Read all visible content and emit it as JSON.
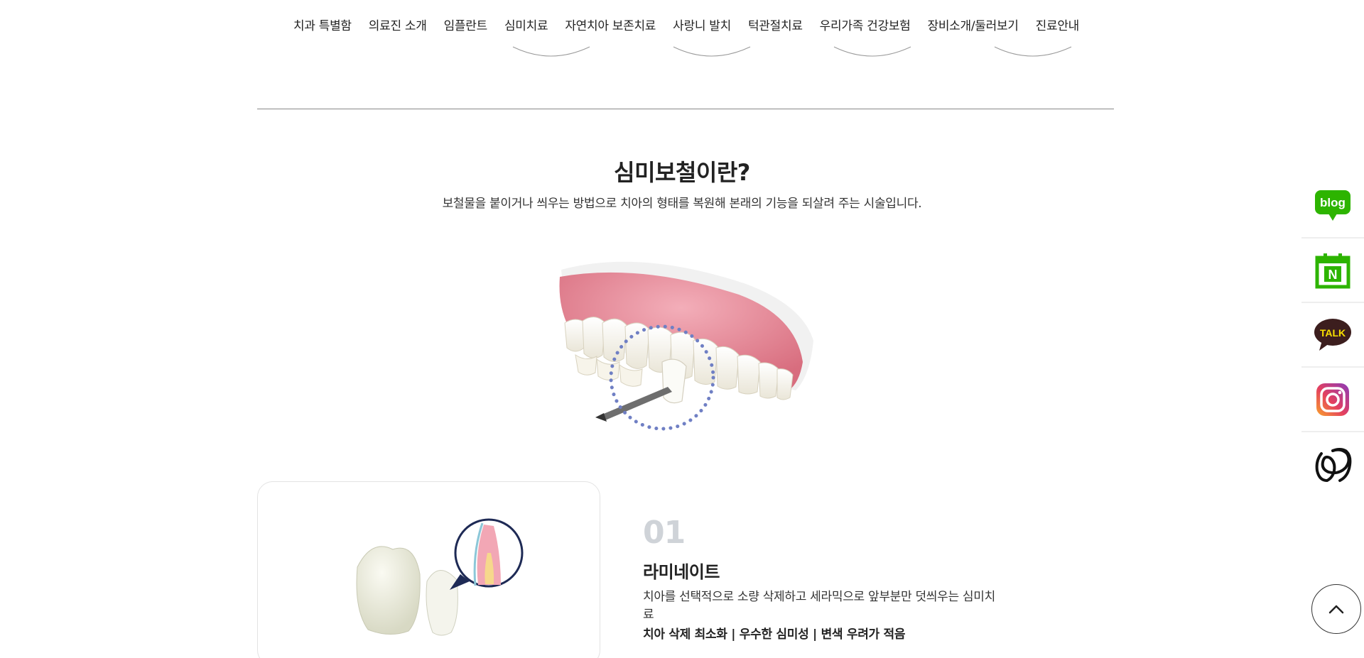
{
  "nav": {
    "items": [
      {
        "label": "치과 특별함"
      },
      {
        "label": "의료진 소개"
      },
      {
        "label": "임플란트"
      },
      {
        "label": "심미치료"
      },
      {
        "label": "자연치아 보존치료"
      },
      {
        "label": "사랑니 발치"
      },
      {
        "label": "턱관절치료"
      },
      {
        "label": "우리가족 건강보험"
      },
      {
        "label": "장비소개/둘러보기"
      },
      {
        "label": "진료안내"
      }
    ]
  },
  "section": {
    "title": "심미보철이란?",
    "subtitle": "보철물을 붙이거나 씌우는 방법으로 치아의 형태를 복원해 본래의 기능을 되살려 주는 시술입니다."
  },
  "item": {
    "number": "01",
    "title": "라미네이트",
    "description": "치아를 선택적으로 소량 삭제하고 세라믹으로 앞부분만 덧씌우는 심미치료",
    "points": "치아 삭제 최소화 | 우수한 심미성 | 변색 우려가 적음"
  },
  "sidebar": {
    "blog_label": "blog",
    "talk_label": "TALK",
    "calendar_letter": "N"
  },
  "colors": {
    "naver_green": "#2db400",
    "kakao_dark": "#3c1e1e",
    "kakao_yellow": "#f9e000",
    "dot_blue": "#6f7fc4",
    "number_gray": "#cfd3d8"
  }
}
